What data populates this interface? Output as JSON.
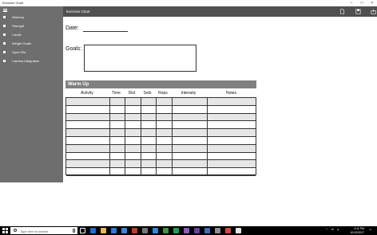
{
  "window": {
    "title": "Exercise Chart"
  },
  "sidebar": {
    "items": [
      {
        "label": "Warmup"
      },
      {
        "label": "Strenght"
      },
      {
        "label": "Cardio"
      },
      {
        "label": "Weight Goals"
      },
      {
        "label": "Open File"
      },
      {
        "label": "Camera Integration"
      }
    ]
  },
  "header": {
    "title": "Exercise Chart",
    "icons": [
      "new-file-icon",
      "save-icon",
      "share-icon"
    ]
  },
  "form": {
    "date_label": "Date:",
    "goals_label": "Goals:"
  },
  "warmup": {
    "title": "Warm Up",
    "columns": [
      "Activity",
      "Time",
      "Dist",
      "Sets",
      "Reps",
      "Intensity",
      "Notes"
    ],
    "row_count": 10
  },
  "taskbar": {
    "search_placeholder": "Type here to search",
    "time": "4:11 PM",
    "date": "10/13/2017"
  },
  "colors": {
    "sidebar": "#6e6e6e",
    "header": "#505050",
    "section_bar": "#808080",
    "row_shade": "#e6e6e6"
  }
}
